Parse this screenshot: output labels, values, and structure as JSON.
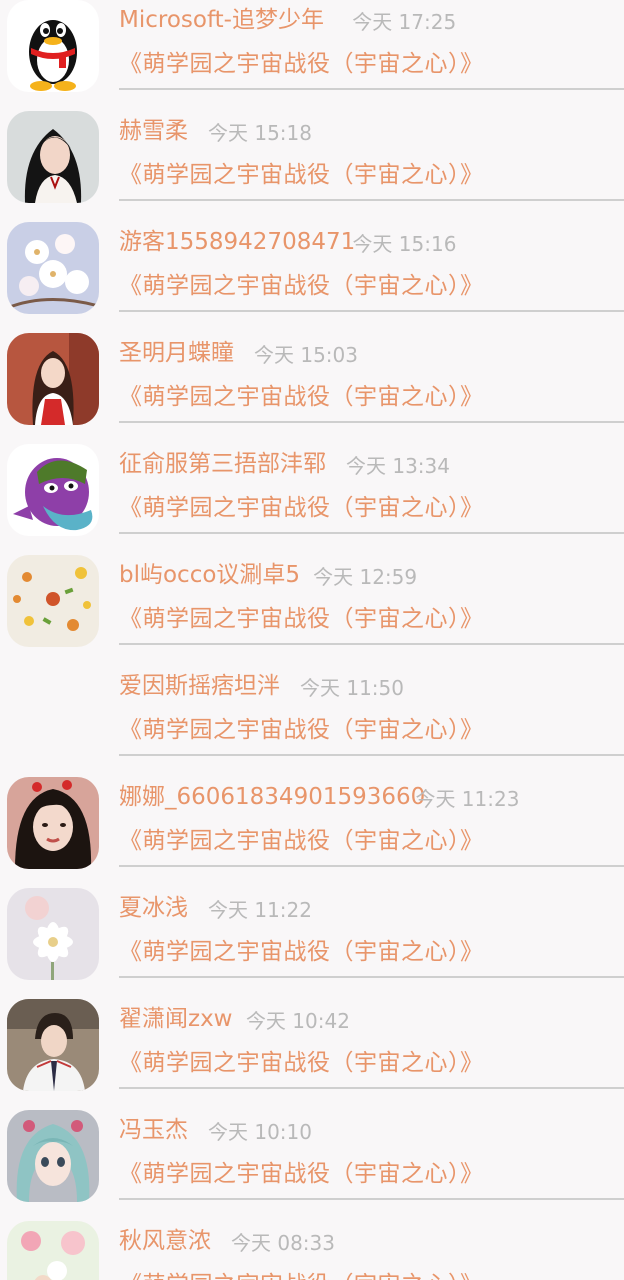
{
  "chats": [
    {
      "name": "Microsoft-追梦少年",
      "time": "今天 17:25",
      "message": "《萌学园之宇宙战役（宇宙之心）》",
      "avatar": "qq-penguin-icon"
    },
    {
      "name": "赫雪柔",
      "time": "今天 15:18",
      "message": "《萌学园之宇宙战役（宇宙之心）》",
      "avatar": "girl-photo-avatar"
    },
    {
      "name": "游客1558942708471",
      "time": "今天 15:16",
      "message": "《萌学园之宇宙战役（宇宙之心）》",
      "avatar": "blossom-photo-avatar"
    },
    {
      "name": "圣明月蝶瞳",
      "time": "今天 15:03",
      "message": "《萌学园之宇宙战役（宇宙之心）》",
      "avatar": "girl-red-dress-avatar"
    },
    {
      "name": "征俞服第三捂部沣郓",
      "time": "今天 13:34",
      "message": "《萌学园之宇宙战役（宇宙之心）》",
      "avatar": "purple-cartoon-avatar"
    },
    {
      "name": "bl屿occo议涮卓5",
      "time": "今天 12:59",
      "message": "《萌学园之宇宙战役（宇宙之心）》",
      "avatar": "food-photo-avatar"
    },
    {
      "name": "爱因斯摇痞坦泮",
      "time": "今天 11:50",
      "message": "《萌学园之宇宙战役（宇宙之心）》",
      "avatar": ""
    },
    {
      "name": "娜娜_66061834901593660",
      "time": "今天 11:23",
      "message": "《萌学园之宇宙战役（宇宙之心）》",
      "avatar": "girl-portrait-avatar"
    },
    {
      "name": "夏冰浅",
      "time": "今天 11:22",
      "message": "《萌学园之宇宙战役（宇宙之心）》",
      "avatar": "white-flower-avatar"
    },
    {
      "name": "翟潇闻zxw",
      "time": "今天 10:42",
      "message": "《萌学园之宇宙战役（宇宙之心）》",
      "avatar": "boy-photo-avatar"
    },
    {
      "name": "冯玉杰",
      "time": "今天 10:10",
      "message": "《萌学园之宇宙战役（宇宙之心）》",
      "avatar": "anime-girl-avatar"
    },
    {
      "name": "秋风意浓",
      "time": "今天 08:33",
      "message": "《萌学园之宇宙战役（宇宙之心）》",
      "avatar": "flower-cartoon-avatar"
    }
  ],
  "colors": {
    "accent": "#e8956a",
    "time": "#b9b9b9",
    "divider": "#cfcfcf",
    "background": "#f9f7f8"
  }
}
